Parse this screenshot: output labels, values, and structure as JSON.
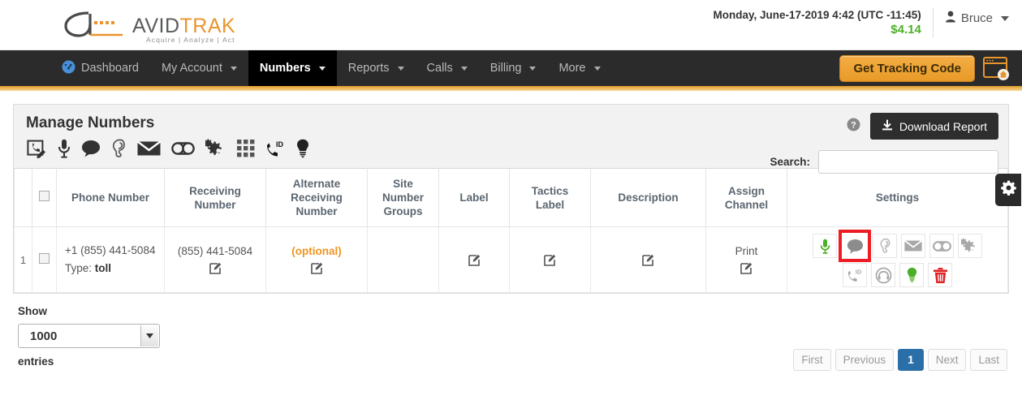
{
  "brand": {
    "name_dark": "AVID",
    "name_orange": "TRAK",
    "tagline": "Acquire   |   Analyze   |   Act",
    "logo_icon": "avidtrak-a-logo"
  },
  "header": {
    "datetime": "Monday, June-17-2019 4:42 (UTC -11:45)",
    "balance": "$4.14",
    "user_name": "Bruce",
    "user_icon": "person-icon",
    "user_caret_icon": "chevron-down-icon"
  },
  "nav": {
    "items": [
      {
        "label": "Dashboard",
        "icon": "dashboard-gauge-icon",
        "caret": false,
        "active": false
      },
      {
        "label": "My Account",
        "icon": "",
        "caret": true,
        "active": false
      },
      {
        "label": "Numbers",
        "icon": "",
        "caret": true,
        "active": true
      },
      {
        "label": "Reports",
        "icon": "",
        "caret": true,
        "active": false
      },
      {
        "label": "Calls",
        "icon": "",
        "caret": true,
        "active": false
      },
      {
        "label": "Billing",
        "icon": "",
        "caret": true,
        "active": false
      },
      {
        "label": "More",
        "icon": "",
        "caret": true,
        "active": false
      }
    ],
    "tracking_button": "Get Tracking Code",
    "tracking_icon": "browser-window-home-icon"
  },
  "card": {
    "title": "Manage Numbers",
    "help_icon": "help-circle-icon",
    "download_label": "Download Report",
    "download_icon": "download-icon",
    "search_label": "Search:",
    "search_value": "",
    "search_placeholder": "",
    "legend_icons": [
      "phone-edit-icon",
      "microphone-icon",
      "speech-bubble-icon",
      "ear-whisper-icon",
      "envelope-icon",
      "voicemail-infinity-icon",
      "gears-icon",
      "keypad-grid-icon",
      "phone-caller-id-icon",
      "lightbulb-icon"
    ],
    "settings_tab_icon": "gear-icon"
  },
  "table": {
    "columns": [
      "",
      "",
      "Phone Number",
      "Receiving\nNumber",
      "Alternate\nReceiving\nNumber",
      "Site\nNumber\nGroups",
      "Label",
      "Tactics\nLabel",
      "Description",
      "Assign\nChannel",
      "Settings"
    ],
    "headers": {
      "index": "",
      "select_all": "",
      "phone_number": "Phone Number",
      "receiving_number_l1": "Receiving",
      "receiving_number_l2": "Number",
      "alternate_l1": "Alternate",
      "alternate_l2": "Receiving",
      "alternate_l3": "Number",
      "site_groups_l1": "Site",
      "site_groups_l2": "Number",
      "site_groups_l3": "Groups",
      "label": "Label",
      "tactics_l1": "Tactics",
      "tactics_l2": "Label",
      "description": "Description",
      "assign_channel_l1": "Assign",
      "assign_channel_l2": "Channel",
      "settings": "Settings"
    },
    "rows": [
      {
        "index": "1",
        "phone_number": "+1 (855) 441-5084",
        "type_prefix": "Type:",
        "type_value": "toll",
        "receiving_number": "(855) 441-5084",
        "alternate_receiving_number": "(optional)",
        "site_number_groups": "",
        "label": "",
        "tactics_label": "",
        "description": "",
        "assign_channel": "Print",
        "settings_icons_row1": [
          {
            "icon": "microphone-icon",
            "color": "#4caf27",
            "highlighted": false
          },
          {
            "icon": "speech-bubble-icon",
            "color": "#8c8c8c",
            "highlighted": true
          },
          {
            "icon": "ear-whisper-icon",
            "color": "#b5b5b5",
            "highlighted": false
          },
          {
            "icon": "envelope-icon",
            "color": "#a8a8a8",
            "highlighted": false
          },
          {
            "icon": "voicemail-infinity-icon",
            "color": "#a8a8a8",
            "highlighted": false
          },
          {
            "icon": "gears-icon",
            "color": "#a8a8a8",
            "highlighted": false
          }
        ],
        "settings_icons_row2": [
          {
            "icon": "phone-caller-id-icon",
            "color": "#a8a8a8",
            "highlighted": false
          },
          {
            "icon": "headset-icon",
            "color": "#a8a8a8",
            "highlighted": false
          },
          {
            "icon": "lightbulb-icon",
            "color": "#4caf27",
            "highlighted": false
          },
          {
            "icon": "trash-icon",
            "color": "#e02222",
            "highlighted": false
          }
        ],
        "edit_icon": "edit-square-icon"
      }
    ]
  },
  "footer": {
    "show_label": "Show",
    "entries_value": "1000",
    "entries_label": "entries",
    "select_caret_icon": "chevron-down-icon",
    "pagination": [
      {
        "label": "First",
        "active": false
      },
      {
        "label": "Previous",
        "active": false
      },
      {
        "label": "1",
        "active": true
      },
      {
        "label": "Next",
        "active": false
      },
      {
        "label": "Last",
        "active": false
      }
    ]
  },
  "colors": {
    "nav_bg": "#2b2b2b",
    "accent_orange": "#e8952e",
    "balance_green": "#4caf27",
    "highlight_red": "#ee1c24",
    "pager_active_blue": "#2a6fa8"
  }
}
